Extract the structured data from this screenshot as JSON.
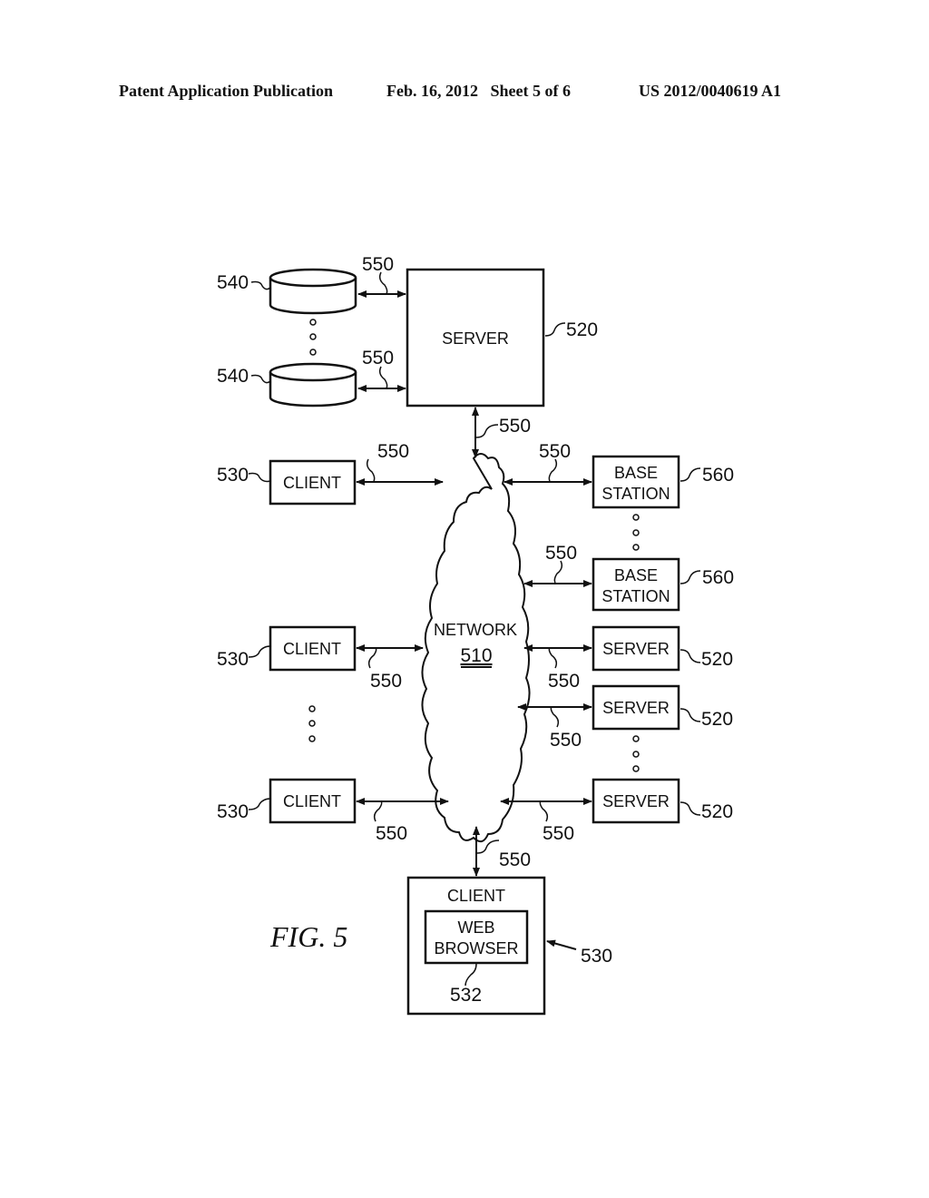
{
  "header": {
    "publication": "Patent Application Publication",
    "date_sheet": "Feb. 16, 2012   Sheet 5 of 6",
    "number": "US 2012/0040619 A1"
  },
  "figure": {
    "caption": "FIG. 5",
    "network": {
      "label": "NETWORK",
      "ref": "510"
    },
    "main_server": {
      "label": "SERVER",
      "ref": "520"
    },
    "storage": [
      {
        "ref": "540"
      },
      {
        "ref": "540"
      }
    ],
    "clients": [
      {
        "label": "CLIENT",
        "ref": "530"
      },
      {
        "label": "CLIENT",
        "ref": "530"
      },
      {
        "label": "CLIENT",
        "ref": "530"
      }
    ],
    "base_stations": [
      {
        "label_line1": "BASE",
        "label_line2": "STATION",
        "ref": "560"
      },
      {
        "label_line1": "BASE",
        "label_line2": "STATION",
        "ref": "560"
      }
    ],
    "servers": [
      {
        "label": "SERVER",
        "ref": "520"
      },
      {
        "label": "SERVER",
        "ref": "520"
      },
      {
        "label": "SERVER",
        "ref": "520"
      }
    ],
    "bottom_client": {
      "label": "CLIENT",
      "ref": "530",
      "browser_line1": "WEB",
      "browser_line2": "BROWSER",
      "browser_ref": "532"
    },
    "link_ref": "550"
  }
}
